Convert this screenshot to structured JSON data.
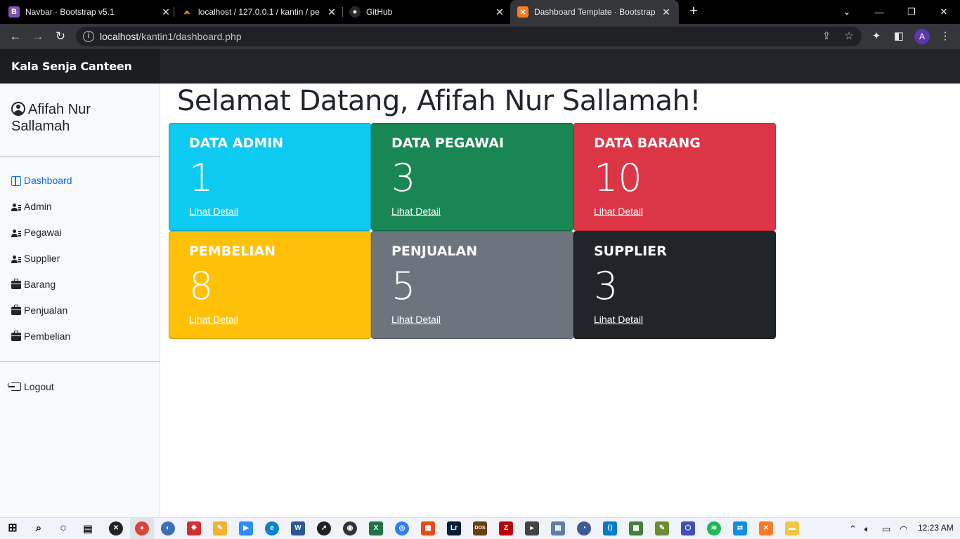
{
  "browser": {
    "tabs": [
      {
        "title": "Navbar · Bootstrap v5.1",
        "favicon": "bootstrap-icon"
      },
      {
        "title": "localhost / 127.0.0.1 / kantin / pe",
        "favicon": "phpmyadmin-icon"
      },
      {
        "title": "GitHub",
        "favicon": "github-icon"
      },
      {
        "title": "Dashboard Template · Bootstrap",
        "favicon": "xampp-icon"
      }
    ],
    "url_host": "localhost",
    "url_path": "/kantin1/dashboard.php",
    "profile_initial": "A"
  },
  "navbar": {
    "brand": "Kala Senja Canteen"
  },
  "sidebar": {
    "user_name": "Afifah Nur Sallamah",
    "items": [
      {
        "label": "Dashboard",
        "icon": "dashboard-icon"
      },
      {
        "label": "Admin",
        "icon": "person-lines-icon"
      },
      {
        "label": "Pegawai",
        "icon": "person-lines-icon"
      },
      {
        "label": "Supplier",
        "icon": "person-lines-icon"
      },
      {
        "label": "Barang",
        "icon": "bag-icon"
      },
      {
        "label": "Penjualan",
        "icon": "bag-icon"
      },
      {
        "label": "Pembelian",
        "icon": "bag-icon"
      }
    ],
    "logout": "Logout"
  },
  "main": {
    "title": "Selamat Datang, Afifah Nur Sallamah!",
    "cards": [
      {
        "title": "DATA ADMIN",
        "value": "1",
        "link": "Lihat Detail",
        "color": "#0dcaf0"
      },
      {
        "title": "DATA PEGAWAI",
        "value": "3",
        "link": "Lihat Detail",
        "color": "#198754"
      },
      {
        "title": "DATA BARANG",
        "value": "10",
        "link": "Lihat Detail",
        "color": "#dc3545"
      },
      {
        "title": "PEMBELIAN",
        "value": "8",
        "link": "Lihat Detail",
        "color": "#ffc107"
      },
      {
        "title": "PENJUALAN",
        "value": "5",
        "link": "Lihat Detail",
        "color": "#6c757d"
      },
      {
        "title": "SUPPLIER",
        "value": "3",
        "link": "Lihat Detail",
        "color": "#212529"
      }
    ]
  },
  "taskbar": {
    "clock": "12:23 AM"
  }
}
